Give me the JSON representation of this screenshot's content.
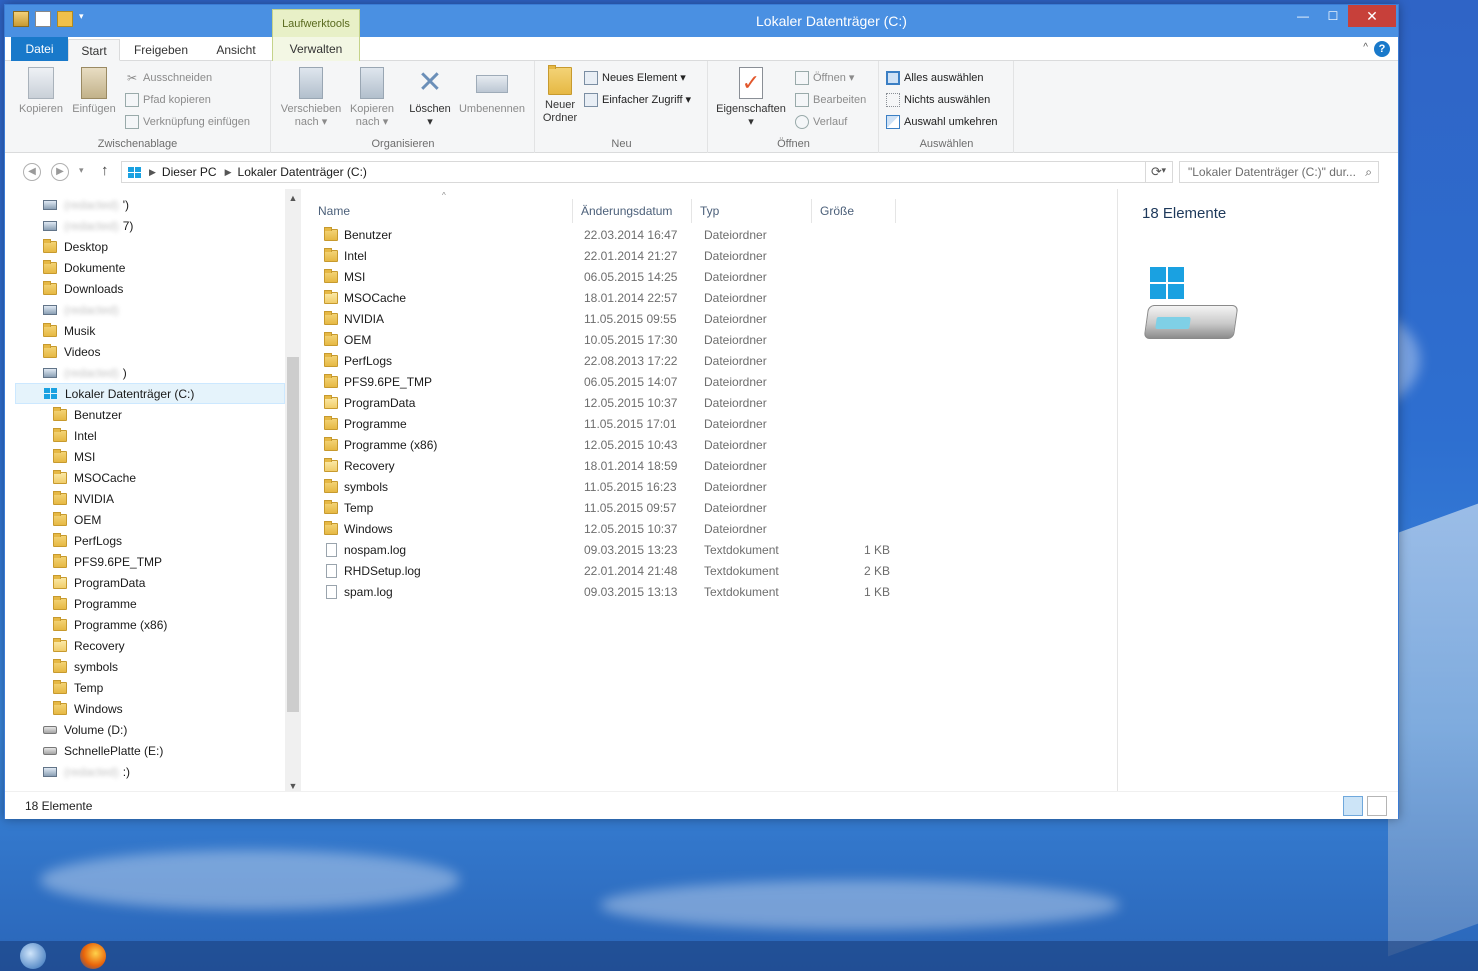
{
  "window": {
    "title": "Lokaler Datenträger (C:)",
    "context_tab_group": "Laufwerktools",
    "controls": {
      "minimize": "—",
      "maximize": "☐",
      "close": "✕"
    }
  },
  "ribbon_tabs": [
    {
      "label": "Datei",
      "state": "file"
    },
    {
      "label": "Start",
      "state": "active"
    },
    {
      "label": "Freigeben",
      "state": "normal"
    },
    {
      "label": "Ansicht",
      "state": "normal"
    },
    {
      "label": "Verwalten",
      "state": "context"
    }
  ],
  "ribbon": {
    "clipboard": {
      "label": "Zwischenablage",
      "copy": "Kopieren",
      "paste": "Einfügen",
      "cut": "Ausschneiden",
      "copy_path": "Pfad kopieren",
      "paste_shortcut": "Verknüpfung einfügen"
    },
    "organize": {
      "label": "Organisieren",
      "move_to": [
        "Verschieben",
        "nach ▾"
      ],
      "copy_to": [
        "Kopieren",
        "nach ▾"
      ],
      "delete": [
        "Löschen",
        "▾"
      ],
      "rename": "Umbenennen"
    },
    "new": {
      "label": "Neu",
      "new_folder": [
        "Neuer",
        "Ordner"
      ],
      "new_item": "Neues Element ▾",
      "easy_access": "Einfacher Zugriff ▾"
    },
    "open": {
      "label": "Öffnen",
      "properties": [
        "Eigenschaften",
        "▾"
      ],
      "open": "Öffnen ▾",
      "edit": "Bearbeiten",
      "history": "Verlauf"
    },
    "select": {
      "label": "Auswählen",
      "select_all": "Alles auswählen",
      "select_none": "Nichts auswählen",
      "invert": "Auswahl umkehren"
    }
  },
  "address": {
    "breadcrumb": [
      "Dieser PC",
      "Lokaler Datenträger (C:)"
    ],
    "search_placeholder": "\"Lokaler Datenträger (C:)\" dur..."
  },
  "nav_pane": [
    {
      "label": "(redacted)",
      "icon": "network-drive-icon",
      "indent": 0,
      "blurred": true,
      "suffix": "')"
    },
    {
      "label": "(redacted)",
      "icon": "network-drive-icon",
      "indent": 0,
      "blurred": true,
      "suffix": "7)"
    },
    {
      "label": "Desktop",
      "icon": "folder-icon",
      "indent": 0
    },
    {
      "label": "Dokumente",
      "icon": "folder-icon",
      "indent": 0
    },
    {
      "label": "Downloads",
      "icon": "folder-icon",
      "indent": 0
    },
    {
      "label": "(redacted)",
      "icon": "network-drive-icon",
      "indent": 0,
      "blurred": true,
      "suffix": ""
    },
    {
      "label": "Musik",
      "icon": "folder-icon",
      "indent": 0
    },
    {
      "label": "Videos",
      "icon": "folder-icon",
      "indent": 0
    },
    {
      "label": "(redacted)",
      "icon": "network-drive-icon",
      "indent": 0,
      "blurred": true,
      "suffix": ")"
    },
    {
      "label": "Lokaler Datenträger (C:)",
      "icon": "windows-drive-icon",
      "indent": 0,
      "selected": true
    },
    {
      "label": "Benutzer",
      "icon": "folder-icon",
      "indent": 1
    },
    {
      "label": "Intel",
      "icon": "folder-icon",
      "indent": 1
    },
    {
      "label": "MSI",
      "icon": "folder-icon",
      "indent": 1
    },
    {
      "label": "MSOCache",
      "icon": "folder-open-icon",
      "indent": 1
    },
    {
      "label": "NVIDIA",
      "icon": "folder-icon",
      "indent": 1
    },
    {
      "label": "OEM",
      "icon": "folder-icon",
      "indent": 1
    },
    {
      "label": "PerfLogs",
      "icon": "folder-icon",
      "indent": 1
    },
    {
      "label": "PFS9.6PE_TMP",
      "icon": "folder-icon",
      "indent": 1
    },
    {
      "label": "ProgramData",
      "icon": "folder-open-icon",
      "indent": 1
    },
    {
      "label": "Programme",
      "icon": "folder-icon",
      "indent": 1
    },
    {
      "label": "Programme (x86)",
      "icon": "folder-icon",
      "indent": 1
    },
    {
      "label": "Recovery",
      "icon": "folder-open-icon",
      "indent": 1
    },
    {
      "label": "symbols",
      "icon": "folder-icon",
      "indent": 1
    },
    {
      "label": "Temp",
      "icon": "folder-icon",
      "indent": 1
    },
    {
      "label": "Windows",
      "icon": "folder-icon",
      "indent": 1
    },
    {
      "label": "Volume (D:)",
      "icon": "drive-icon",
      "indent": 0
    },
    {
      "label": "SchnellePlatte (E:)",
      "icon": "drive-icon",
      "indent": 0
    },
    {
      "label": "(redacted)",
      "icon": "network-drive-icon",
      "indent": 0,
      "blurred": true,
      "suffix": ":)"
    }
  ],
  "columns": {
    "name": "Name",
    "date": "Änderungsdatum",
    "type": "Typ",
    "size": "Größe"
  },
  "files": [
    {
      "name": "Benutzer",
      "date": "22.03.2014 16:47",
      "type": "Dateiordner",
      "size": "",
      "icon": "folder-icon"
    },
    {
      "name": "Intel",
      "date": "22.01.2014 21:27",
      "type": "Dateiordner",
      "size": "",
      "icon": "folder-icon"
    },
    {
      "name": "MSI",
      "date": "06.05.2015 14:25",
      "type": "Dateiordner",
      "size": "",
      "icon": "folder-icon"
    },
    {
      "name": "MSOCache",
      "date": "18.01.2014 22:57",
      "type": "Dateiordner",
      "size": "",
      "icon": "folder-open-icon"
    },
    {
      "name": "NVIDIA",
      "date": "11.05.2015 09:55",
      "type": "Dateiordner",
      "size": "",
      "icon": "folder-icon"
    },
    {
      "name": "OEM",
      "date": "10.05.2015 17:30",
      "type": "Dateiordner",
      "size": "",
      "icon": "folder-icon"
    },
    {
      "name": "PerfLogs",
      "date": "22.08.2013 17:22",
      "type": "Dateiordner",
      "size": "",
      "icon": "folder-icon"
    },
    {
      "name": "PFS9.6PE_TMP",
      "date": "06.05.2015 14:07",
      "type": "Dateiordner",
      "size": "",
      "icon": "folder-icon"
    },
    {
      "name": "ProgramData",
      "date": "12.05.2015 10:37",
      "type": "Dateiordner",
      "size": "",
      "icon": "folder-open-icon"
    },
    {
      "name": "Programme",
      "date": "11.05.2015 17:01",
      "type": "Dateiordner",
      "size": "",
      "icon": "folder-icon"
    },
    {
      "name": "Programme (x86)",
      "date": "12.05.2015 10:43",
      "type": "Dateiordner",
      "size": "",
      "icon": "folder-icon"
    },
    {
      "name": "Recovery",
      "date": "18.01.2014 18:59",
      "type": "Dateiordner",
      "size": "",
      "icon": "folder-open-icon"
    },
    {
      "name": "symbols",
      "date": "11.05.2015 16:23",
      "type": "Dateiordner",
      "size": "",
      "icon": "folder-icon"
    },
    {
      "name": "Temp",
      "date": "11.05.2015 09:57",
      "type": "Dateiordner",
      "size": "",
      "icon": "folder-icon"
    },
    {
      "name": "Windows",
      "date": "12.05.2015 10:37",
      "type": "Dateiordner",
      "size": "",
      "icon": "folder-icon"
    },
    {
      "name": "nospam.log",
      "date": "09.03.2015 13:23",
      "type": "Textdokument",
      "size": "1 KB",
      "icon": "text-file-icon"
    },
    {
      "name": "RHDSetup.log",
      "date": "22.01.2014 21:48",
      "type": "Textdokument",
      "size": "2 KB",
      "icon": "text-file-icon"
    },
    {
      "name": "spam.log",
      "date": "09.03.2015 13:13",
      "type": "Textdokument",
      "size": "1 KB",
      "icon": "text-file-icon"
    }
  ],
  "preview": {
    "count": "18 Elemente"
  },
  "status": {
    "count": "18 Elemente"
  },
  "colors": {
    "accent": "#1979ca",
    "titlebar": "#4a90e2",
    "close": "#c7403a",
    "context_tab": "#e8f0c7"
  }
}
